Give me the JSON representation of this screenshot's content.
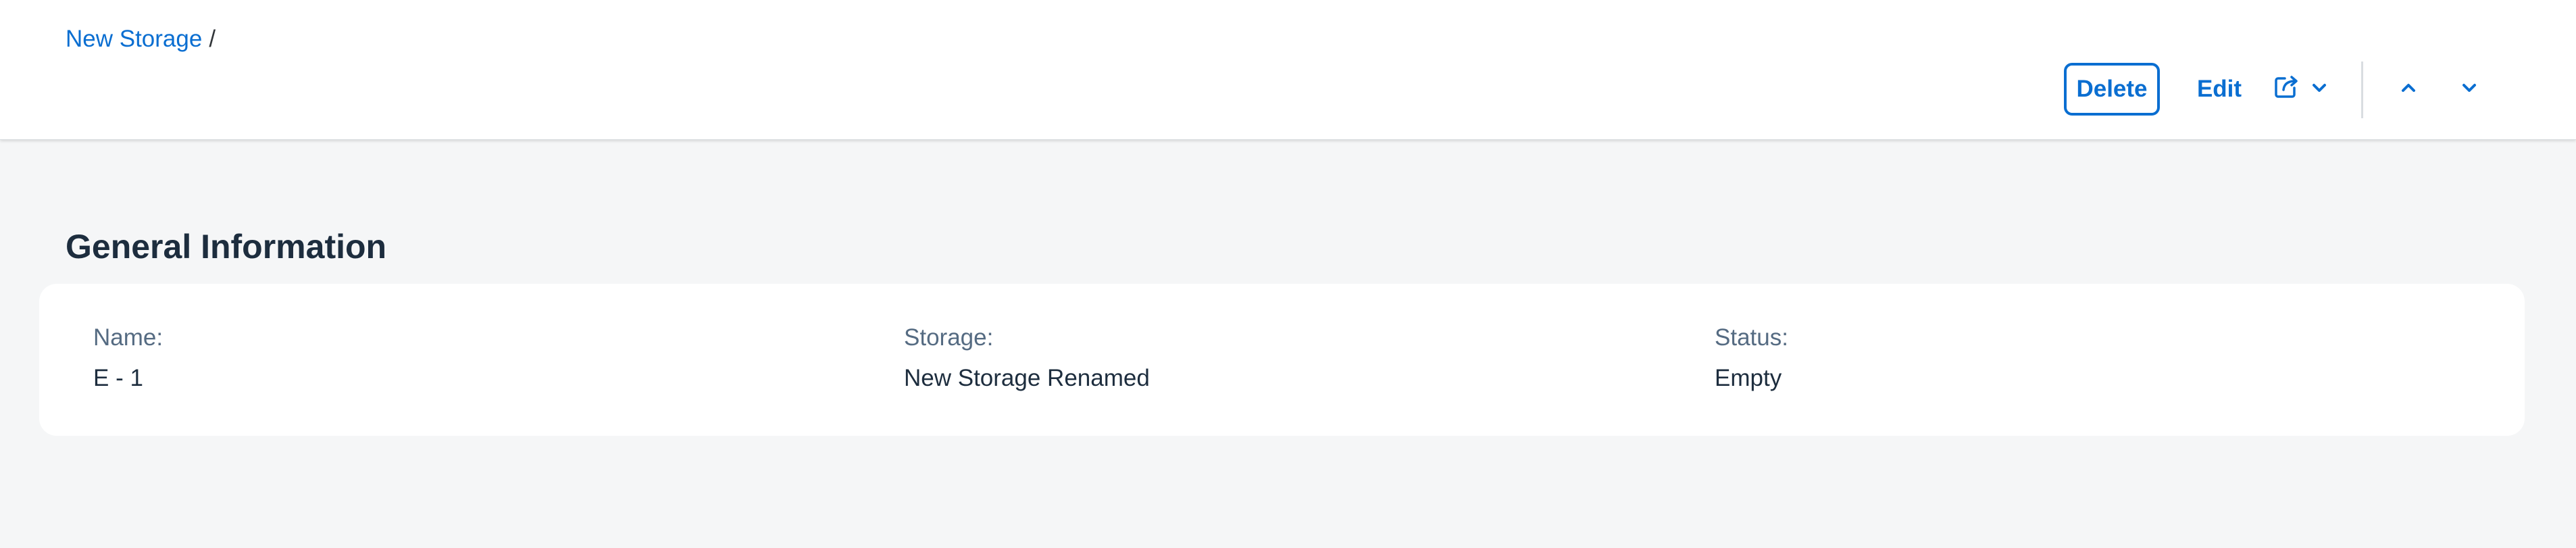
{
  "breadcrumb": {
    "items": [
      {
        "label": "New Storage"
      }
    ],
    "separator": "/"
  },
  "toolbar": {
    "delete_label": "Delete",
    "edit_label": "Edit",
    "share_icon": "share-icon",
    "share_menu_icon": "chevron-down-icon",
    "prev_icon": "chevron-up-icon",
    "next_icon": "chevron-down-icon"
  },
  "section": {
    "title": "General Information",
    "fields": [
      {
        "label": "Name:",
        "value": "E - 1"
      },
      {
        "label": "Storage:",
        "value": "New Storage Renamed"
      },
      {
        "label": "Status:",
        "value": "Empty"
      }
    ]
  },
  "colors": {
    "accent": "#0a6ed1",
    "background": "#f5f6f7",
    "text": "#1d2d3e",
    "label": "#556b82"
  }
}
